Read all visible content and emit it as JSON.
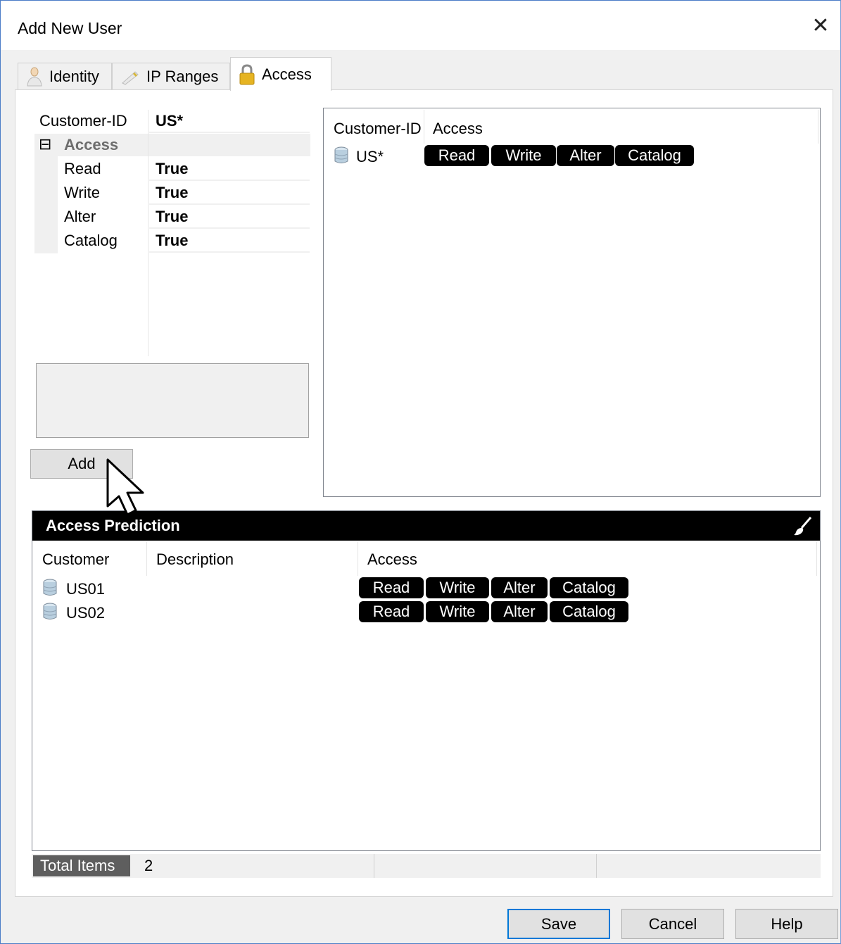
{
  "window": {
    "title": "Add New User"
  },
  "tabs": [
    {
      "label": "Identity",
      "icon": "person-icon"
    },
    {
      "label": "IP Ranges",
      "icon": "pencil-icon"
    },
    {
      "label": "Access",
      "icon": "lock-icon",
      "active": true
    }
  ],
  "property_grid": {
    "customer_id_label": "Customer-ID",
    "customer_id_value": "US*",
    "category_label": "Access",
    "expand_glyph": "⊟",
    "rows": [
      {
        "key": "Read",
        "value": "True"
      },
      {
        "key": "Write",
        "value": "True"
      },
      {
        "key": "Alter",
        "value": "True"
      },
      {
        "key": "Catalog",
        "value": "True"
      }
    ]
  },
  "add_button": "Add",
  "access_list": {
    "headers": [
      "Customer-ID",
      "Access"
    ],
    "rows": [
      {
        "customer": "US*",
        "access": [
          "Read",
          "Write",
          "Alter",
          "Catalog"
        ]
      }
    ]
  },
  "prediction": {
    "title": "Access Prediction",
    "headers": [
      "Customer",
      "Description",
      "Access"
    ],
    "rows": [
      {
        "customer": "US01",
        "description": "",
        "access": [
          "Read",
          "Write",
          "Alter",
          "Catalog"
        ]
      },
      {
        "customer": "US02",
        "description": "",
        "access": [
          "Read",
          "Write",
          "Alter",
          "Catalog"
        ]
      }
    ]
  },
  "status": {
    "total_label": "Total Items",
    "total_value": "2"
  },
  "footer": {
    "save": "Save",
    "cancel": "Cancel",
    "help": "Help"
  },
  "colors": {
    "pill": "#000000",
    "accent": "#0078d7",
    "window_bg": "#f0f0f0"
  }
}
